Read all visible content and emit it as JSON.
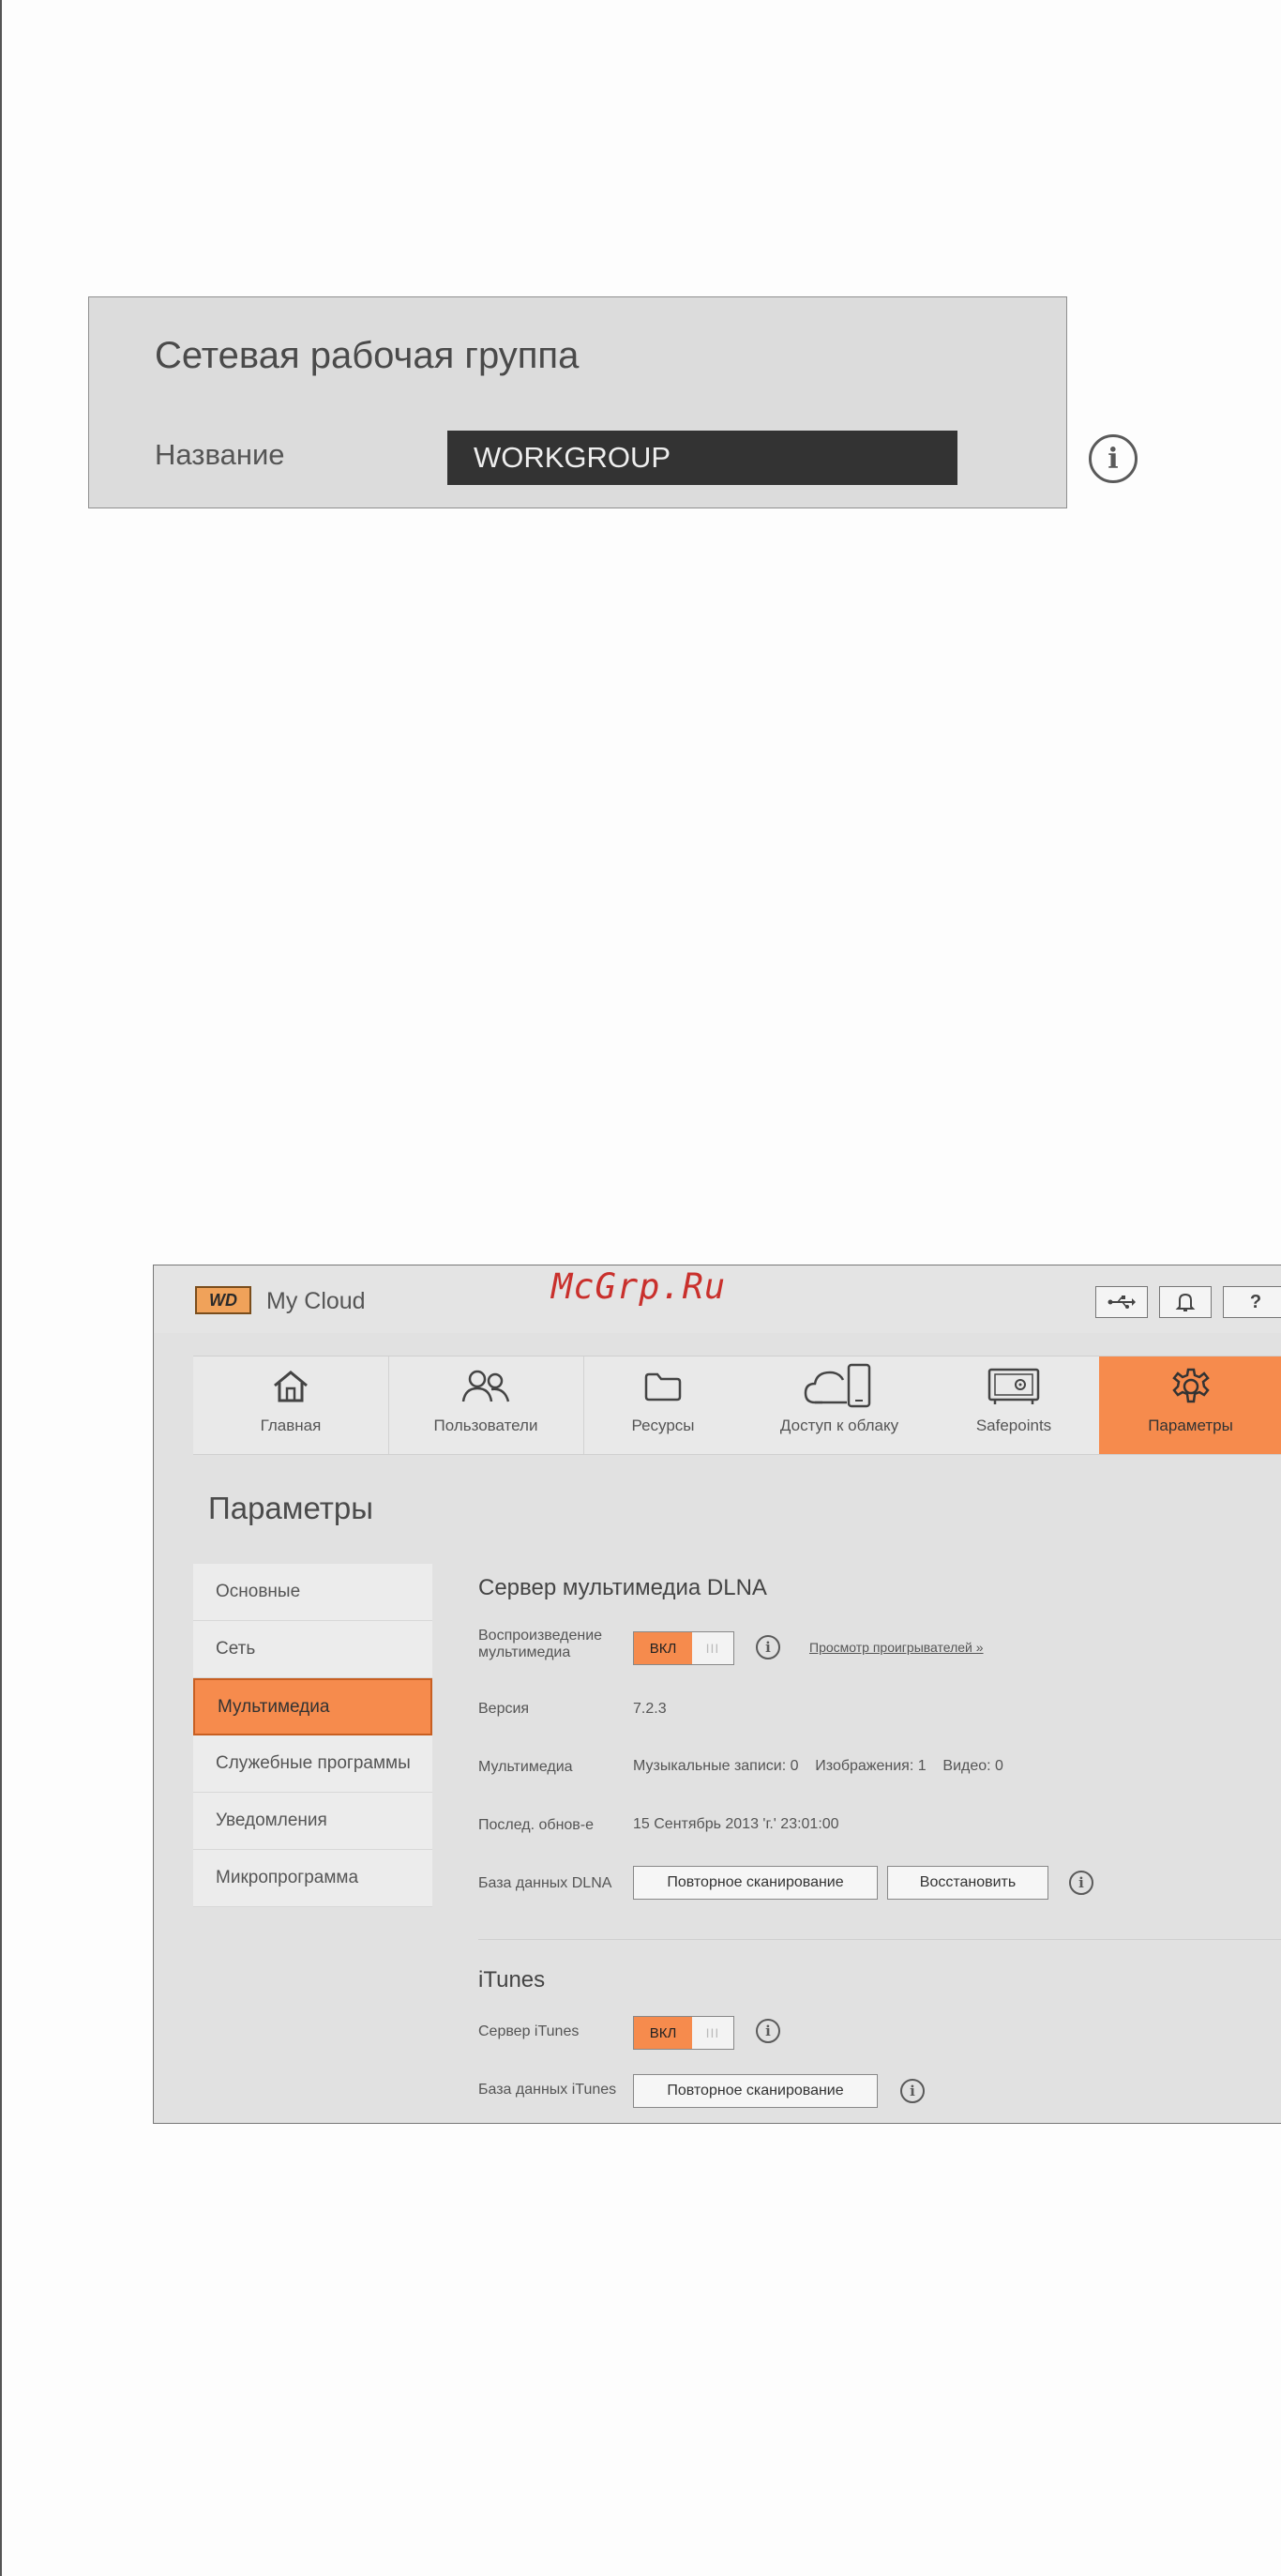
{
  "workgroup": {
    "title": "Сетевая рабочая группа",
    "name_label": "Название",
    "name_value": "WORKGROUP",
    "info_icon": "info-icon"
  },
  "watermark": "McGrp.Ru",
  "app": {
    "logo_mark": "WD",
    "logo_name": "My Cloud",
    "top_buttons": {
      "usb_icon": "usb-icon",
      "bell_icon": "bell-icon",
      "help_label": "?"
    },
    "nav": [
      {
        "label": "Главная",
        "icon": "home-icon"
      },
      {
        "label": "Пользователи",
        "icon": "users-icon"
      },
      {
        "label": "Ресурсы",
        "icon": "folder-icon"
      },
      {
        "label": "Доступ к облаку",
        "icon": "cloud-device-icon"
      },
      {
        "label": "Safepoints",
        "icon": "safe-icon"
      },
      {
        "label": "Параметры",
        "icon": "gear-icon"
      }
    ],
    "page_title": "Параметры",
    "sidebar": [
      {
        "label": "Основные"
      },
      {
        "label": "Сеть"
      },
      {
        "label": "Мультимедиа"
      },
      {
        "label": "Служебные программы"
      },
      {
        "label": "Уведомления"
      },
      {
        "label": "Микропрограмма"
      }
    ],
    "dlna": {
      "title": "Сервер мультимедиа DLNA",
      "playback_label": "Воспроизведение мультимедиа",
      "toggle_on": "ВКЛ",
      "toggle_grip": "III",
      "players_link": "Просмотр проигрывателей »",
      "version_label": "Версия",
      "version_value": "7.2.3",
      "media_label": "Мультимедиа",
      "media_value": "Музыкальные записи: 0    Изображения: 1    Видео: 0",
      "last_update_label": "Послед. обнов-е",
      "last_update_value": "15 Сентябрь 2013 'г.' 23:01:00",
      "db_label": "База данных DLNA",
      "rescan_button": "Повторное сканирование",
      "restore_button": "Восстановить"
    },
    "itunes": {
      "title": "iTunes",
      "server_label": "Сервер iTunes",
      "toggle_on": "ВКЛ",
      "toggle_grip": "III",
      "db_label": "База данных iTunes",
      "rescan_button": "Повторное сканирование"
    }
  },
  "colors": {
    "accent": "#f68b4d",
    "panel_bg": "#dcdcdc",
    "input_bg": "#333333"
  }
}
